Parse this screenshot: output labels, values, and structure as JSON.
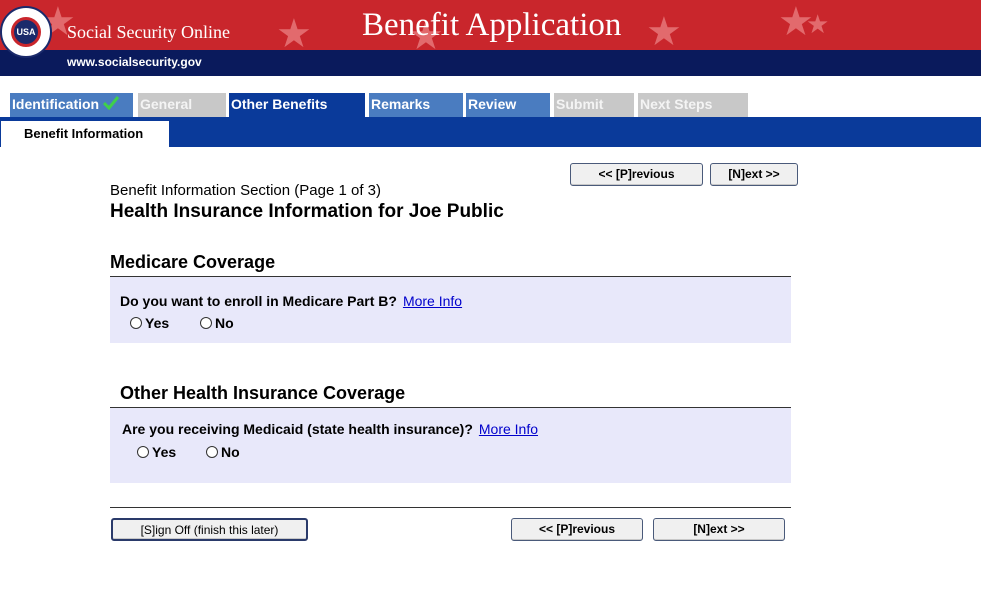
{
  "header": {
    "site_name": "Social Security Online",
    "app_title": "Benefit Application",
    "url": "www.socialsecurity.gov",
    "seal_text": "USA"
  },
  "tabs": [
    {
      "label": "Identification",
      "state": "completed"
    },
    {
      "label": "General",
      "state": "disabled"
    },
    {
      "label": "Other Benefits",
      "state": "active"
    },
    {
      "label": "Remarks",
      "state": "available"
    },
    {
      "label": "Review",
      "state": "available"
    },
    {
      "label": "Submit",
      "state": "disabled"
    },
    {
      "label": "Next Steps",
      "state": "disabled"
    }
  ],
  "subtab": {
    "label": "Benefit Information"
  },
  "nav": {
    "previous_label": "<< [P]revious",
    "next_label": "[N]ext >>",
    "signoff_label": "[S]ign Off (finish this later)"
  },
  "content": {
    "section_line": "Benefit Information Section (Page 1 of 3)",
    "title": "Health Insurance Information for Joe Public",
    "medicare": {
      "heading": "Medicare Coverage",
      "question": "Do you want to enroll in Medicare Part B?",
      "more_info": "More Info",
      "yes_label": "Yes",
      "no_label": "No"
    },
    "other": {
      "heading": "Other Health Insurance Coverage",
      "question": "Are you receiving Medicaid (state health insurance)?",
      "more_info": "More Info",
      "yes_label": "Yes",
      "no_label": "No"
    }
  },
  "colors": {
    "banner_red": "#c9262c",
    "navy": "#0a1a5c",
    "tab_blue": "#4a7cc0",
    "active_blue": "#0a3a9a",
    "panel_bg": "#e8e8fa",
    "link": "#0000cc"
  }
}
